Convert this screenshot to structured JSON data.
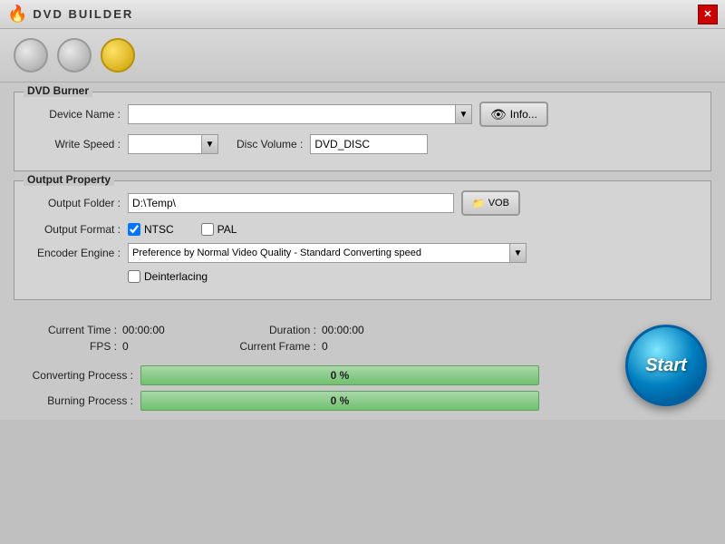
{
  "titleBar": {
    "title": "DVD BUILDER",
    "closeLabel": "✕",
    "flameEmoji": "🔥"
  },
  "toolbar": {
    "buttons": [
      {
        "id": "btn1",
        "label": "",
        "active": false
      },
      {
        "id": "btn2",
        "label": "",
        "active": false
      },
      {
        "id": "btn3",
        "label": "",
        "active": true
      }
    ]
  },
  "dvdBurner": {
    "groupTitle": "DVD Burner",
    "deviceNameLabel": "Device Name :",
    "deviceNameValue": "",
    "deviceNamePlaceholder": "",
    "infoButtonLabel": "Info...",
    "writeSpeedLabel": "Write Speed :",
    "writeSpeedValue": "",
    "discVolumeLabel": "Disc Volume :",
    "discVolumeValue": "DVD_DISC"
  },
  "outputProperty": {
    "groupTitle": "Output Property",
    "outputFolderLabel": "Output Folder :",
    "outputFolderValue": "D:\\Temp\\",
    "vobButtonLabel": "VOB",
    "outputFormatLabel": "Output Format :",
    "ntscLabel": "NTSC",
    "ntscChecked": true,
    "palLabel": "PAL",
    "palChecked": false,
    "encoderEngineLabel": "Encoder Engine :",
    "encoderEngineValue": "Preference by Normal Video Quality - Standard Converting speed",
    "deinterlacingLabel": "Deinterlacing",
    "deinterlacingChecked": false
  },
  "infoSection": {
    "currentTimeLabel": "Current Time :",
    "currentTimeValue": "00:00:00",
    "durationLabel": "Duration :",
    "durationValue": "00:00:00",
    "fpsLabel": "FPS :",
    "fpsValue": "0",
    "currentFrameLabel": "Current Frame :",
    "currentFrameValue": "0"
  },
  "progressSection": {
    "convertingLabel": "Converting Process :",
    "convertingValue": "0 %",
    "burningLabel": "Burning Process :",
    "burningValue": "0 %"
  },
  "startButton": {
    "label": "Start"
  }
}
